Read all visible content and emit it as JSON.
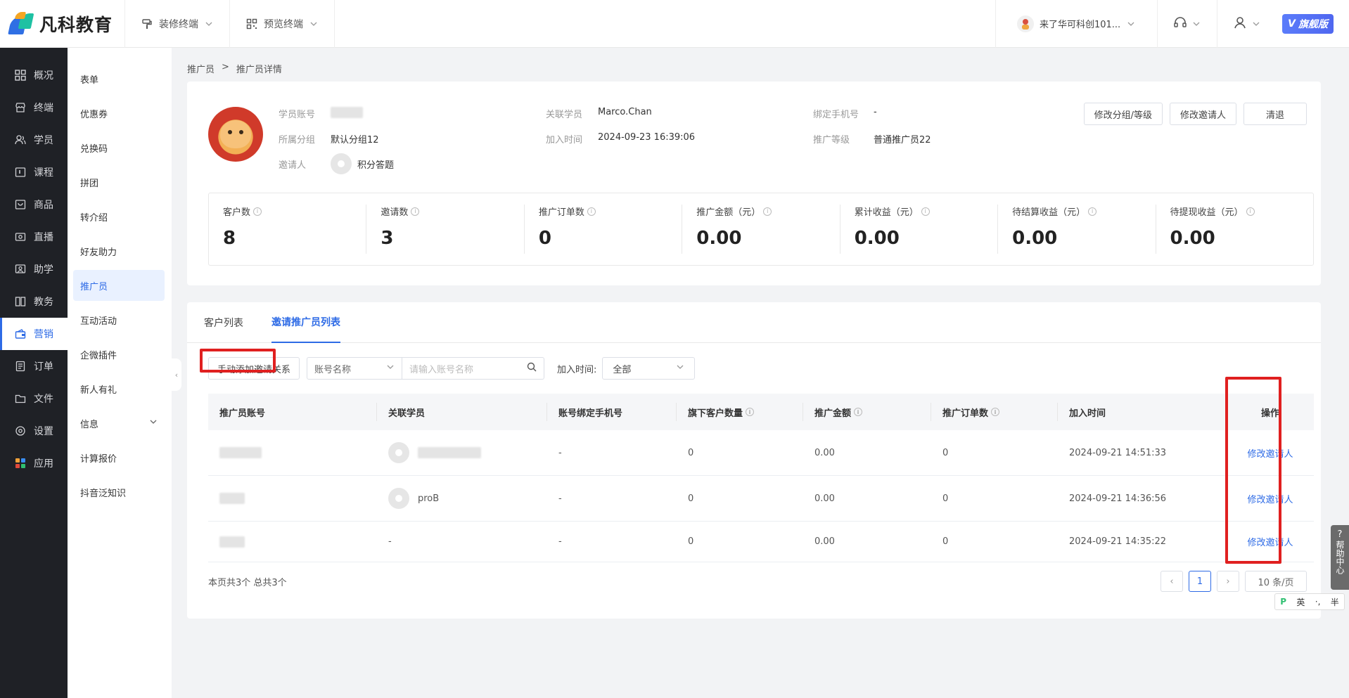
{
  "header": {
    "brand": "凡科教育",
    "nav": [
      {
        "label": "装修终端"
      },
      {
        "label": "预览终端"
      }
    ],
    "account": "来了华可科创101...",
    "edition_badge": "旗舰版"
  },
  "sidebar": {
    "items": [
      {
        "label": "概况",
        "icon": "grid-icon"
      },
      {
        "label": "终端",
        "icon": "store-icon"
      },
      {
        "label": "学员",
        "icon": "users-icon"
      },
      {
        "label": "课程",
        "icon": "course-icon"
      },
      {
        "label": "商品",
        "icon": "goods-icon"
      },
      {
        "label": "直播",
        "icon": "live-icon"
      },
      {
        "label": "助学",
        "icon": "assist-icon"
      },
      {
        "label": "教务",
        "icon": "book-icon"
      },
      {
        "label": "营销",
        "icon": "marketing-icon"
      },
      {
        "label": "订单",
        "icon": "order-icon"
      },
      {
        "label": "文件",
        "icon": "folder-icon"
      },
      {
        "label": "设置",
        "icon": "gear-icon"
      },
      {
        "label": "应用",
        "icon": "apps-icon"
      }
    ],
    "active_index": 8
  },
  "subsidebar": {
    "items": [
      {
        "label": "表单"
      },
      {
        "label": "优惠券"
      },
      {
        "label": "兑换码"
      },
      {
        "label": "拼团"
      },
      {
        "label": "转介绍"
      },
      {
        "label": "好友助力"
      },
      {
        "label": "推广员"
      },
      {
        "label": "互动活动"
      },
      {
        "label": "企微插件"
      },
      {
        "label": "新人有礼"
      },
      {
        "label": "信息"
      },
      {
        "label": "计算报价"
      },
      {
        "label": "抖音泛知识"
      }
    ],
    "active_index": 6
  },
  "breadcrumb": {
    "parent": "推广员",
    "sep": ">",
    "current": "推广员详情"
  },
  "profile": {
    "account_label": "学员账号",
    "group_label": "所属分组",
    "group_value": "默认分组12",
    "inviter_label": "邀请人",
    "inviter_value": "积分答题",
    "linked_label": "关联学员",
    "linked_value": "Marco.Chan",
    "join_label": "加入时间",
    "join_value": "2024-09-23 16:39:06",
    "phone_label": "绑定手机号",
    "phone_value": "-",
    "level_label": "推广等级",
    "level_value": "普通推广员22"
  },
  "actions": {
    "edit_group": "修改分组/等级",
    "edit_inviter": "修改邀请人",
    "clear": "清退"
  },
  "stats": [
    {
      "label": "客户数",
      "value": "8"
    },
    {
      "label": "邀请数",
      "value": "3"
    },
    {
      "label": "推广订单数",
      "value": "0"
    },
    {
      "label": "推广金额（元）",
      "value": "0.00"
    },
    {
      "label": "累计收益（元）",
      "value": "0.00"
    },
    {
      "label": "待结算收益（元）",
      "value": "0.00"
    },
    {
      "label": "待提现收益（元）",
      "value": "0.00"
    }
  ],
  "tabs": [
    {
      "label": "客户列表"
    },
    {
      "label": "邀请推广员列表"
    }
  ],
  "active_tab": 1,
  "toolbar": {
    "add_relation": "手动添加邀请关系",
    "filter_select": "账号名称",
    "search_placeholder": "请输入账号名称",
    "join_time_label": "加入时间:",
    "join_time_value": "全部"
  },
  "table": {
    "headers": [
      "推广员账号",
      "关联学员",
      "账号绑定手机号",
      "旗下客户数量",
      "推广金额",
      "推广订单数",
      "加入时间",
      "操作"
    ],
    "rows": [
      {
        "student": "",
        "phone": "-",
        "customers": "0",
        "amount": "0.00",
        "orders": "0",
        "join_time": "2024-09-21 14:51:33",
        "action": "修改邀请人"
      },
      {
        "student": "proB",
        "phone": "-",
        "customers": "0",
        "amount": "0.00",
        "orders": "0",
        "join_time": "2024-09-21 14:36:56",
        "action": "修改邀请人"
      },
      {
        "student": "-",
        "phone": "-",
        "customers": "0",
        "amount": "0.00",
        "orders": "0",
        "join_time": "2024-09-21 14:35:22",
        "action": "修改邀请人"
      }
    ]
  },
  "footer": {
    "summary": "本页共3个 总共3个",
    "current_page": "1",
    "page_size": "10 条/页"
  },
  "help": "帮助中心",
  "ime": {
    "lang": "英",
    "punct": "·,",
    "width": "半"
  },
  "colors": {
    "accent": "#2e6be6",
    "highlight": "#e02020",
    "sidebar_bg": "#1f2126"
  }
}
